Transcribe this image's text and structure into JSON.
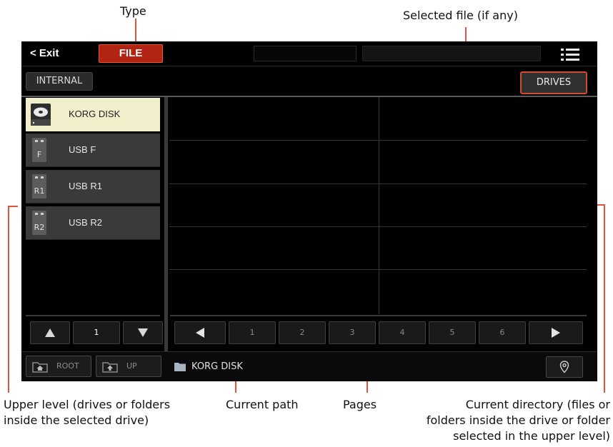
{
  "callouts": {
    "type": "Type",
    "selected_file": "Selected file (if any)",
    "upper_level_1": "Upper level (drives or folders",
    "upper_level_2": "inside the selected drive)",
    "current_path": "Current path",
    "pages": "Pages",
    "current_dir_1": "Current directory (files or",
    "current_dir_2": "folders inside the drive or folder",
    "current_dir_3": "selected in the upper level)"
  },
  "topbar": {
    "exit_label": "< Exit",
    "type_button": "FILE",
    "menu_icon": "list-menu-icon"
  },
  "tabs": {
    "internal": "INTERNAL",
    "drives": "DRIVES"
  },
  "drives": [
    {
      "label": "KORG DISK",
      "icon": "disk-icon",
      "selected": true
    },
    {
      "label": "USB F",
      "icon_letter": "F",
      "icon": "usb-icon",
      "selected": false
    },
    {
      "label": "USB R1",
      "icon_letter": "R1",
      "icon": "usb-icon",
      "selected": false
    },
    {
      "label": "USB R2",
      "icon_letter": "R2",
      "icon": "usb-icon",
      "selected": false
    }
  ],
  "upper_nav": {
    "page": "1"
  },
  "pages": [
    "1",
    "2",
    "3",
    "4",
    "5",
    "6"
  ],
  "bottom": {
    "root_label": "ROOT",
    "up_label": "UP",
    "current_path": "KORG DISK"
  },
  "colors": {
    "accent": "#e0533d",
    "type_button_bg": "#b32314",
    "selected_drive_bg": "#f0eecb",
    "screen_bg": "#000000"
  }
}
